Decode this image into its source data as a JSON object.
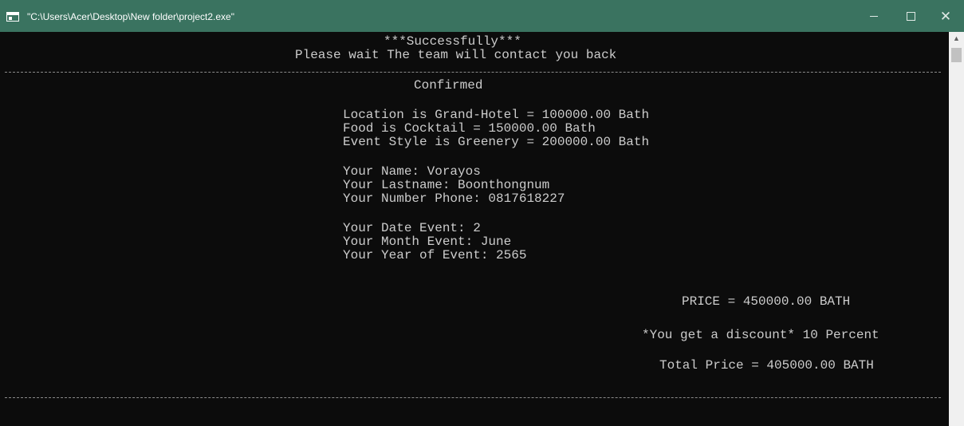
{
  "window": {
    "title": "\"C:\\Users\\Acer\\Desktop\\New folder\\project2.exe\"",
    "close_glyph": "✕"
  },
  "console": {
    "header": {
      "success": "***Successfully***",
      "wait": "Please wait The team will contact you back"
    },
    "confirmed": "Confirmed",
    "selections": [
      "Location is Grand-Hotel = 100000.00 Bath",
      "Food is Cocktail = 150000.00 Bath",
      "Event Style is Greenery = 200000.00 Bath"
    ],
    "customer": [
      "Your Name: Vorayos",
      "Your Lastname: Boonthongnum",
      "Your Number Phone: 0817618227"
    ],
    "event_date": [
      "Your Date Event: 2",
      "Your Month Event: June",
      "Your Year of Event: 2565"
    ],
    "price": "PRICE = 450000.00 BATH",
    "discount": "*You get a discount* 10 Percent",
    "total": "Total Price = 405000.00 BATH"
  },
  "scrollbar": {
    "up_arrow": "▲"
  },
  "colors": {
    "titlebar": "#3a7360",
    "console_bg": "#0c0c0c",
    "console_text": "#cccccc"
  }
}
